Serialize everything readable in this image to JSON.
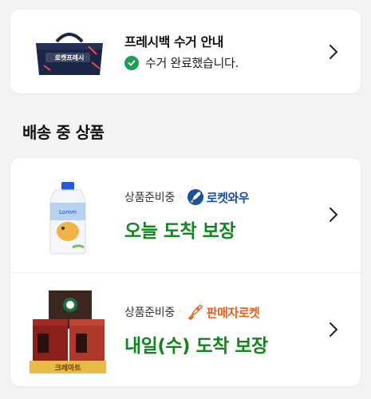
{
  "fresh_bag": {
    "bag_brand_text": "로켓프레시",
    "title": "프레시백 수거 안내",
    "status": "수거 완료했습니다.",
    "status_color": "#1f9d55"
  },
  "section": {
    "title": "배송 중 상품"
  },
  "orders": [
    {
      "status": "상품준비중",
      "separator": "·",
      "badge_label": "로켓와우",
      "badge_color": "#1a4fa6",
      "badge_icon": "rocket-wow-icon",
      "delivery_promise": "오늘 도착 보장",
      "product_image": "laundry-detergent-bottle"
    },
    {
      "status": "상품준비중",
      "separator": "·",
      "badge_label": "판매자로켓",
      "badge_color": "#e2621c",
      "badge_icon": "rocket-seller-icon",
      "delivery_promise": "내일(수) 도착 보장",
      "product_image": "coffee-capsule-boxes",
      "product_box_text": "크레마트"
    }
  ],
  "colors": {
    "delivery_green": "#13851f",
    "background": "#f2f3f5"
  }
}
